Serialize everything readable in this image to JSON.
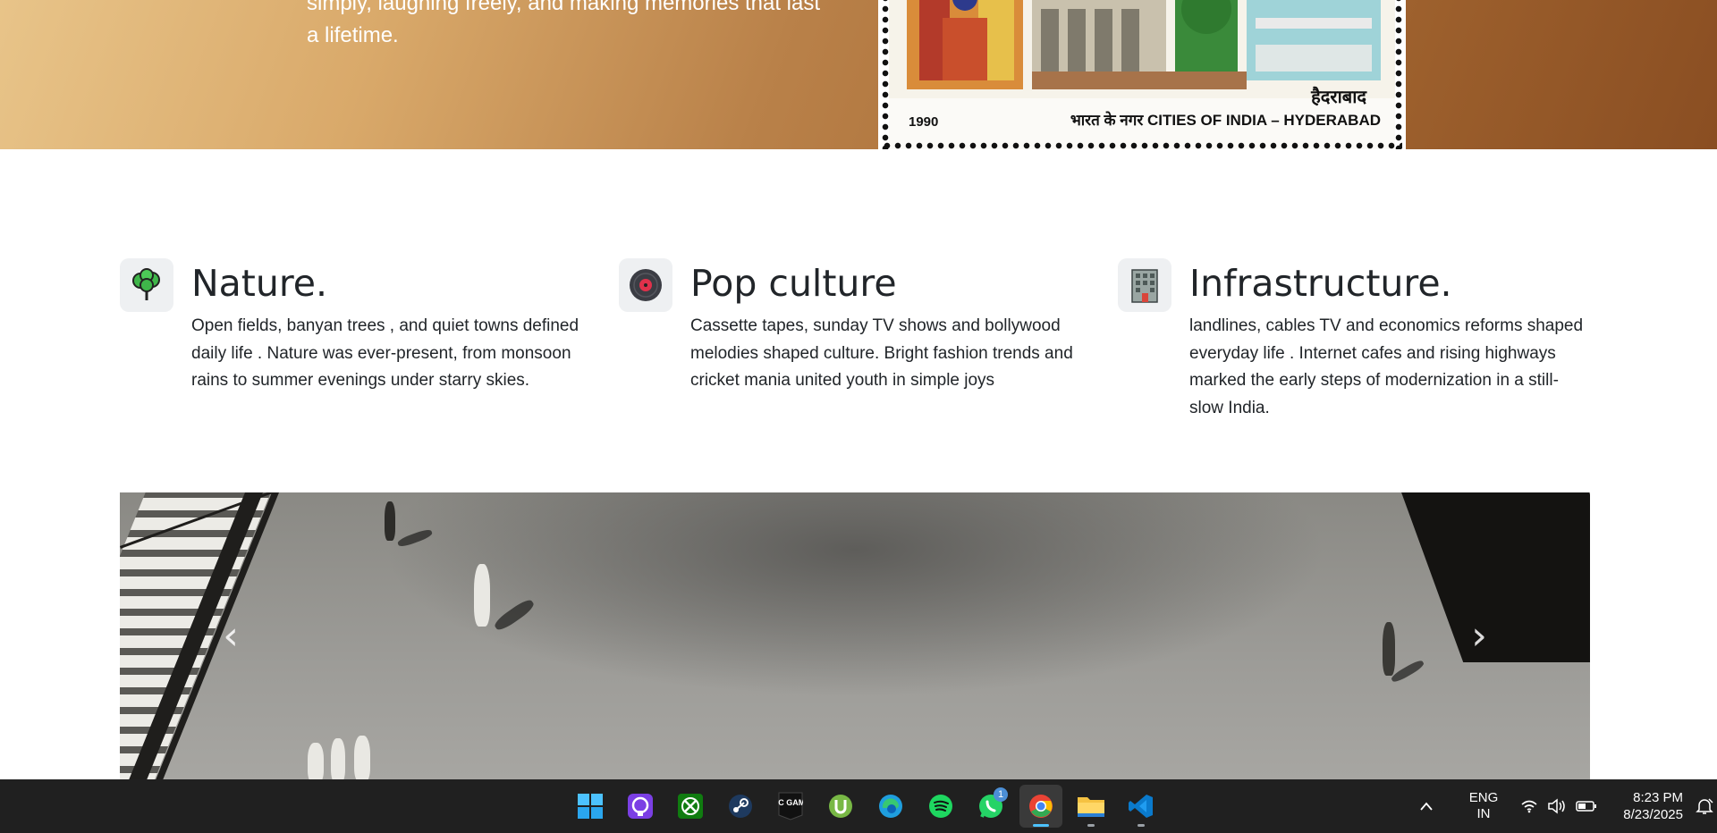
{
  "hero": {
    "text": "simply, laughing freely, and making memories that last a lifetime.",
    "stamp": {
      "year": "1990",
      "hindi_title": "हैदराबाद",
      "caption": "भारत के नगर CITIES OF INDIA – HYDERABAD"
    }
  },
  "features": [
    {
      "icon": "tree-icon",
      "title": "Nature.",
      "text": "Open fields, banyan trees , and quiet towns defined daily life . Nature was ever-present, from monsoon rains to summer evenings under starry skies."
    },
    {
      "icon": "vinyl-record-icon",
      "title": "Pop culture",
      "text": "Cassette tapes, sunday TV shows and bollywood melodies shaped culture. Bright fashion trends and cricket mania united youth in simple joys"
    },
    {
      "icon": "building-icon",
      "title": "Infrastructure.",
      "text": "landlines, cables TV and economics reforms shaped everyday life . Internet cafes and rising highways marked the early steps of modernization in a still-slow India."
    }
  ],
  "carousel": {
    "prev_icon": "chevron-left-icon",
    "next_icon": "chevron-right-icon"
  },
  "taskbar": {
    "apps": [
      {
        "name": "windows-start-icon",
        "color": "#4cc2ff"
      },
      {
        "name": "proton-pass-icon",
        "color": "#8b5cf6"
      },
      {
        "name": "xbox-icon",
        "color": "#107c10"
      },
      {
        "name": "steam-icon",
        "color": "#1b2838"
      },
      {
        "name": "epic-games-icon",
        "color": "#111111",
        "label": "EPIC GAMES"
      },
      {
        "name": "utorrent-icon",
        "color": "#78b845"
      },
      {
        "name": "edge-icon",
        "color": "#1f9ede"
      },
      {
        "name": "spotify-icon",
        "color": "#1ed760"
      },
      {
        "name": "whatsapp-icon",
        "color": "#25d366",
        "badge": "1"
      },
      {
        "name": "chrome-icon",
        "color": "#ea4335",
        "active": true
      },
      {
        "name": "file-explorer-icon",
        "color": "#f5c242"
      },
      {
        "name": "vscode-icon",
        "color": "#0a7acc"
      }
    ],
    "tray": {
      "lang_top": "ENG",
      "lang_bottom": "IN",
      "time": "8:23 PM",
      "date": "8/23/2025"
    }
  }
}
